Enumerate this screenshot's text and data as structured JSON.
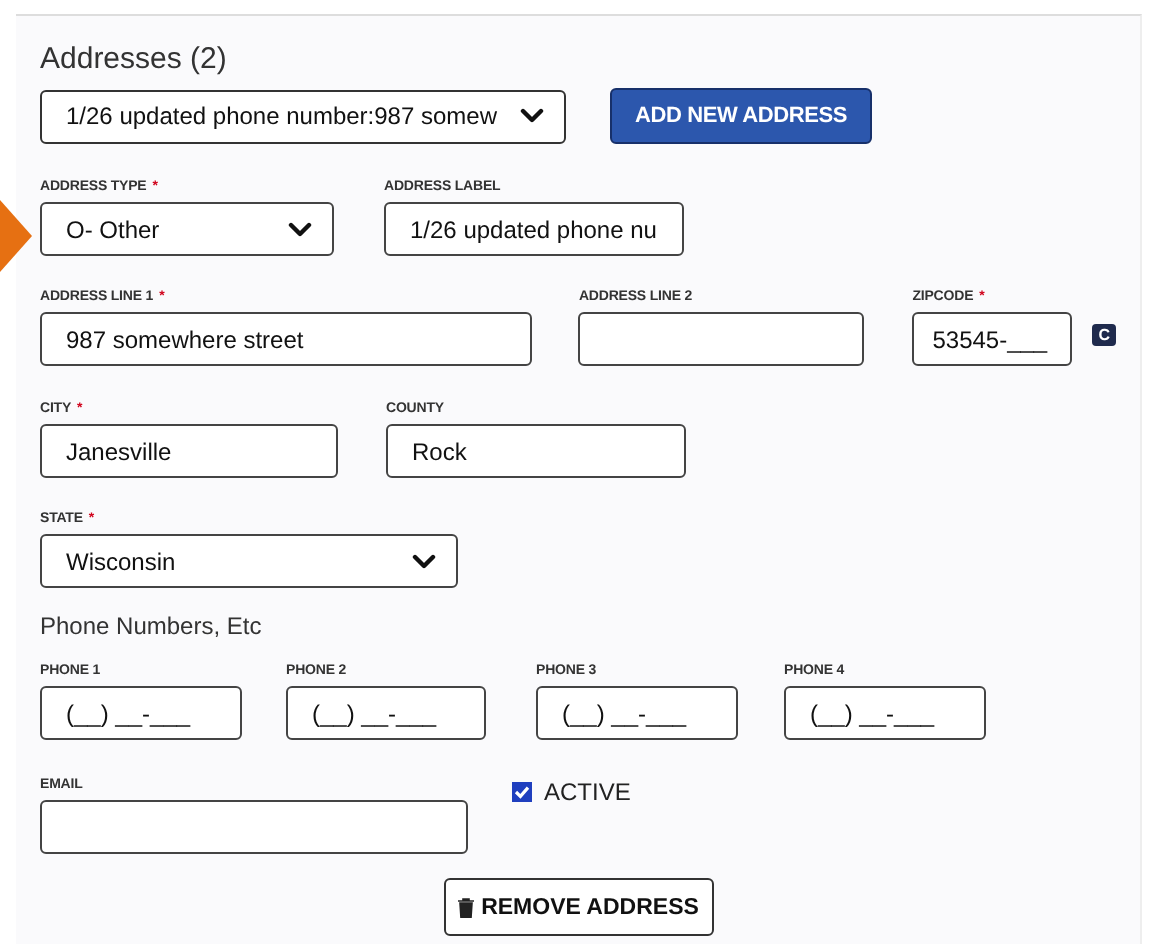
{
  "section": {
    "title": "Addresses (2)"
  },
  "address_picker": {
    "value": "1/26 updated phone number:987 somew"
  },
  "add_button": {
    "label": "ADD NEW ADDRESS"
  },
  "rows": [
    {
      "fields": [
        {
          "kind": "select",
          "label": "ADDRESS TYPE",
          "required_mark": "*",
          "value": "O- Other"
        },
        {
          "kind": "input",
          "label": "ADDRESS LABEL",
          "value": "1/26 updated phone nu"
        }
      ]
    },
    {
      "fields": [
        {
          "kind": "input",
          "label": "ADDRESS LINE 1",
          "required_mark": "*",
          "value": "987 somewhere street"
        },
        {
          "kind": "input",
          "label": "ADDRESS LINE 2"
        },
        {
          "kind": "input",
          "label": "ZIPCODE",
          "required_mark": "*",
          "value": "53545-___",
          "badge": "C"
        }
      ]
    },
    {
      "fields": [
        {
          "kind": "input",
          "label": "CITY",
          "required_mark": "*",
          "value": "Janesville"
        },
        {
          "kind": "input",
          "label": "COUNTY",
          "value": "Rock"
        }
      ]
    },
    {
      "fields": [
        {
          "kind": "select",
          "label": "STATE",
          "required_mark": "*",
          "value": "Wisconsin"
        }
      ]
    },
    {
      "heading": "Phone Numbers, Etc",
      "fields": [
        {
          "kind": "input",
          "label": "PHONE 1",
          "value": "(__) __-___"
        },
        {
          "kind": "input",
          "label": "PHONE 2",
          "value": "(__) __-___"
        },
        {
          "kind": "input",
          "label": "PHONE 3",
          "value": "(__) __-___"
        },
        {
          "kind": "input",
          "label": "PHONE 4",
          "value": "(__) __-___"
        }
      ]
    },
    {
      "fields": [
        {
          "kind": "input",
          "label": "EMAIL"
        },
        {
          "kind": "checkbox",
          "label": "ACTIVE",
          "checked": true
        }
      ]
    }
  ],
  "remove_button": {
    "label": "REMOVE ADDRESS"
  }
}
